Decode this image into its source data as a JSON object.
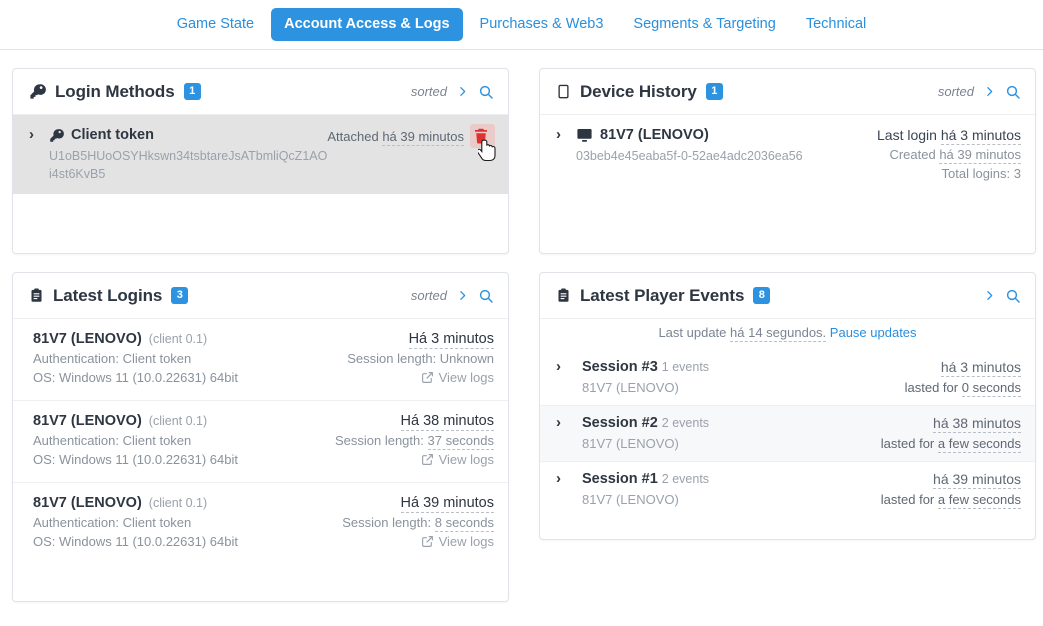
{
  "tabs": [
    {
      "label": "Game State",
      "active": false
    },
    {
      "label": "Account Access & Logs",
      "active": true
    },
    {
      "label": "Purchases & Web3",
      "active": false
    },
    {
      "label": "Segments & Targeting",
      "active": false
    },
    {
      "label": "Technical",
      "active": false
    }
  ],
  "colors": {
    "accent": "#2d93e0",
    "link": "#2a8fdd",
    "danger": "#e03131",
    "text": "#2e3642",
    "muted": "#9aa1ab",
    "row_hover": "#e3e3e3"
  },
  "login_methods": {
    "title": "Login Methods",
    "icon": "key-icon",
    "count": "1",
    "sorted_label": "sorted",
    "row": {
      "name": "Client token",
      "icon": "key-icon",
      "token": "U1oB5HUoOSYHkswn34tsbtareJsATbmliQcZ1AOi4st6KvB5",
      "attached_label": "Attached",
      "attached_value": "há 39 minutos",
      "delete_icon": "trash-icon"
    }
  },
  "device_history": {
    "title": "Device History",
    "icon": "monitor-icon",
    "count": "1",
    "sorted_label": "sorted",
    "row": {
      "name": "81V7 (LENOVO)",
      "icon": "monitor-icon",
      "device_id": "03beb4e45eaba5f-0-52ae4adc2036ea56",
      "last_login_label": "Last login",
      "last_login_value": "há 3 minutos",
      "created_label": "Created",
      "created_value": "há 39 minutos",
      "total_logins": "Total logins: 3"
    }
  },
  "latest_logins": {
    "title": "Latest Logins",
    "icon": "clipboard-icon",
    "count": "3",
    "sorted_label": "sorted",
    "view_logs_label": "View logs",
    "rows": [
      {
        "device": "81V7 (LENOVO)",
        "client": "(client 0.1)",
        "auth": "Authentication: Client token",
        "os": "OS: Windows 11 (10.0.22631) 64bit",
        "timestamp": "Há 3 minutos",
        "session_label": "Session length:",
        "session_value": "Unknown",
        "session_dotted": false
      },
      {
        "device": "81V7 (LENOVO)",
        "client": "(client 0.1)",
        "auth": "Authentication: Client token",
        "os": "OS: Windows 11 (10.0.22631) 64bit",
        "timestamp": "Há 38 minutos",
        "session_label": "Session length:",
        "session_value": "37 seconds",
        "session_dotted": true
      },
      {
        "device": "81V7 (LENOVO)",
        "client": "(client 0.1)",
        "auth": "Authentication: Client token",
        "os": "OS: Windows 11 (10.0.22631) 64bit",
        "timestamp": "Há 39 minutos",
        "session_label": "Session length:",
        "session_value": "8 seconds",
        "session_dotted": true
      }
    ]
  },
  "player_events": {
    "title": "Latest Player Events",
    "icon": "clipboard-icon",
    "count": "8",
    "update_prefix": "Last update",
    "update_value": "há 14 segundos.",
    "pause_label": "Pause updates",
    "rows": [
      {
        "session": "Session #3",
        "events": "1 events",
        "device": "81V7 (LENOVO)",
        "timestamp": "há 3 minutos",
        "lasted_prefix": "lasted for",
        "lasted_value": "0 seconds"
      },
      {
        "session": "Session #2",
        "events": "2 events",
        "device": "81V7 (LENOVO)",
        "timestamp": "há 38 minutos",
        "lasted_prefix": "lasted for",
        "lasted_value": "a few seconds"
      },
      {
        "session": "Session #1",
        "events": "2 events",
        "device": "81V7 (LENOVO)",
        "timestamp": "há 39 minutos",
        "lasted_prefix": "lasted for",
        "lasted_value": "a few seconds"
      }
    ]
  }
}
